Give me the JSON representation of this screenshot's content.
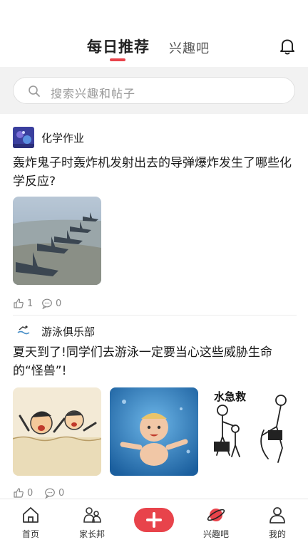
{
  "header": {
    "tabs": [
      {
        "label": "每日推荐",
        "active": true
      },
      {
        "label": "兴趣吧",
        "active": false
      }
    ],
    "notification_icon": "bell-icon"
  },
  "search": {
    "placeholder": "搜索兴趣和帖子",
    "icon": "search-icon"
  },
  "posts": [
    {
      "group": "化学作业",
      "title": "轰炸鬼子时轰炸机发射出去的导弹爆炸发生了哪些化学反应?",
      "images": [
        "fighter-jets-photo"
      ],
      "likes": "1",
      "comments": "0"
    },
    {
      "group": "游泳俱乐部",
      "title": "夏天到了!同学们去游泳一定要当心这些威胁生命的“怪兽”!",
      "images": [
        "drowning-cartoon",
        "baby-underwater-photo",
        "water-rescue-illustration"
      ],
      "image_caption": "水急救",
      "likes": "0",
      "comments": "0"
    }
  ],
  "bottom_nav": [
    {
      "label": "首页",
      "icon": "home-icon"
    },
    {
      "label": "家长邦",
      "icon": "parents-icon"
    },
    {
      "label": "",
      "icon": "plus-icon"
    },
    {
      "label": "兴趣吧",
      "icon": "planet-icon"
    },
    {
      "label": "我的",
      "icon": "profile-icon"
    }
  ],
  "colors": {
    "accent": "#e8434b",
    "search_band": "#f2f2f2"
  }
}
